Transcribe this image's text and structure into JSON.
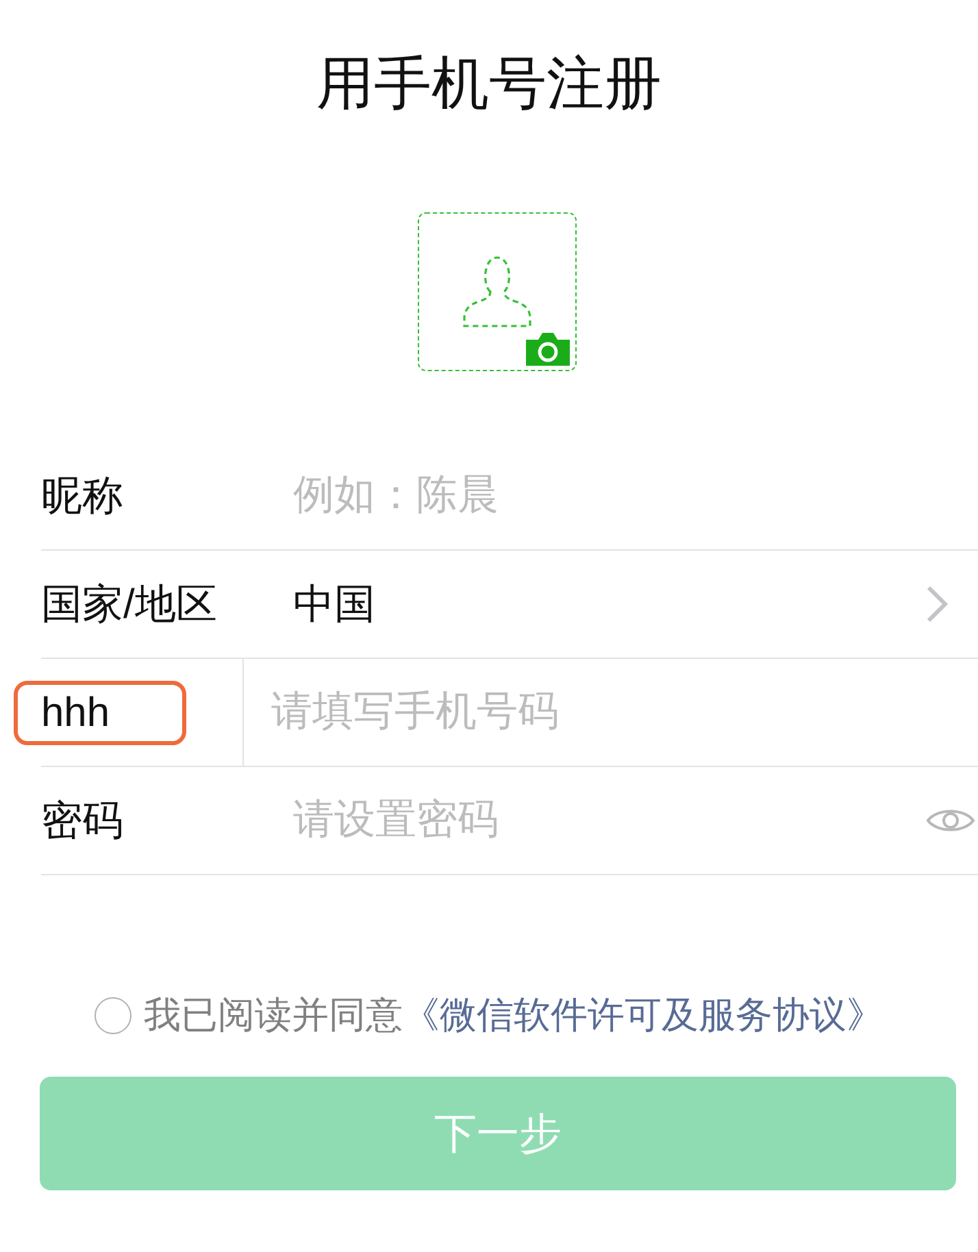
{
  "title": "用手机号注册",
  "fields": [
    {
      "kind": "text",
      "label": "昵称",
      "placeholder": "例如：陈晨"
    },
    {
      "kind": "select",
      "label": "国家/地区",
      "value": "中国"
    },
    {
      "kind": "phone",
      "code": "hhh",
      "highlighted": true,
      "placeholder": "请填写手机号码"
    },
    {
      "kind": "password",
      "label": "密码",
      "placeholder": "请设置密码"
    }
  ],
  "agreement": {
    "checked": false,
    "text": "我已阅读并同意",
    "link": "《微信软件许可及服务协议》"
  },
  "next_button": {
    "label": "下一步",
    "disabled": true
  }
}
